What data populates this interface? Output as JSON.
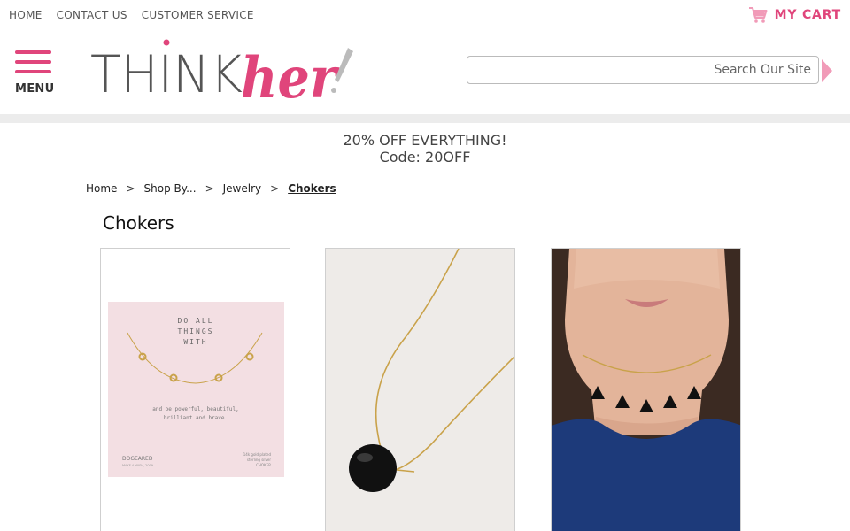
{
  "topnav": {
    "home": "HOME",
    "contact": "CONTACT US",
    "service": "CUSTOMER SERVICE"
  },
  "cart": {
    "label": "MY CART"
  },
  "menu": {
    "label": "MENU"
  },
  "logo": {
    "word1": "THINK",
    "word2": "her"
  },
  "search": {
    "placeholder": "Search Our Site"
  },
  "promo": {
    "line1": "20% OFF EVERYTHING!",
    "line2": "Code: 20OFF"
  },
  "breadcrumb": {
    "items": [
      "Home",
      "Shop By...",
      "Jewelry",
      "Chokers"
    ],
    "separator": ">"
  },
  "page": {
    "title": "Chokers"
  },
  "products": [
    {
      "image": "dogeared-love-necklace-on-pink-card",
      "card_text": {
        "line1": "DO ALL",
        "line2": "THINGS",
        "line3": "WITH",
        "note1": "and be powerful, beautiful,",
        "note2": "brilliant and brave.",
        "brand": "DOGEARED",
        "tagline": "MAKE A WISH, 2009",
        "spec1": "14k gold plated",
        "spec2": "sterling silver",
        "spec3": "CHOKER"
      }
    },
    {
      "image": "gold-chain-black-onyx-bead-necklace"
    },
    {
      "image": "model-wearing-black-tassel-choker"
    }
  ],
  "colors": {
    "accent": "#e0457b",
    "logo_gray": "#555555",
    "band": "#ececec"
  }
}
